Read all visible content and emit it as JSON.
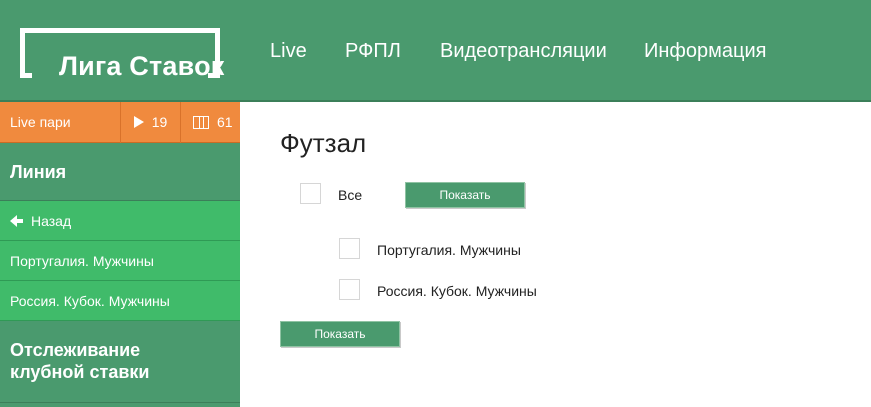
{
  "header": {
    "logo_text": "Лига Ставок",
    "nav": [
      "Live",
      "РФПЛ",
      "Видеотрансляции",
      "Информация"
    ]
  },
  "sidebar": {
    "live_label": "Live пари",
    "live_count_play": "19",
    "live_count_video": "61",
    "section_line": "Линия",
    "items": [
      "Назад",
      "Португалия. Мужчины",
      "Россия. Кубок. Мужчины"
    ],
    "section_tracking_line1": "Отслеживание",
    "section_tracking_line2": "клубной ставки"
  },
  "main": {
    "title": "Футзал",
    "all_label": "Все",
    "show_button": "Показать",
    "leagues": [
      "Португалия. Мужчины",
      "Россия. Кубок. Мужчины"
    ],
    "show_button_bottom": "Показать"
  },
  "colors": {
    "brand_green": "#4a9a6e",
    "light_green": "#40bb6a",
    "live_orange": "#f08a3e"
  }
}
